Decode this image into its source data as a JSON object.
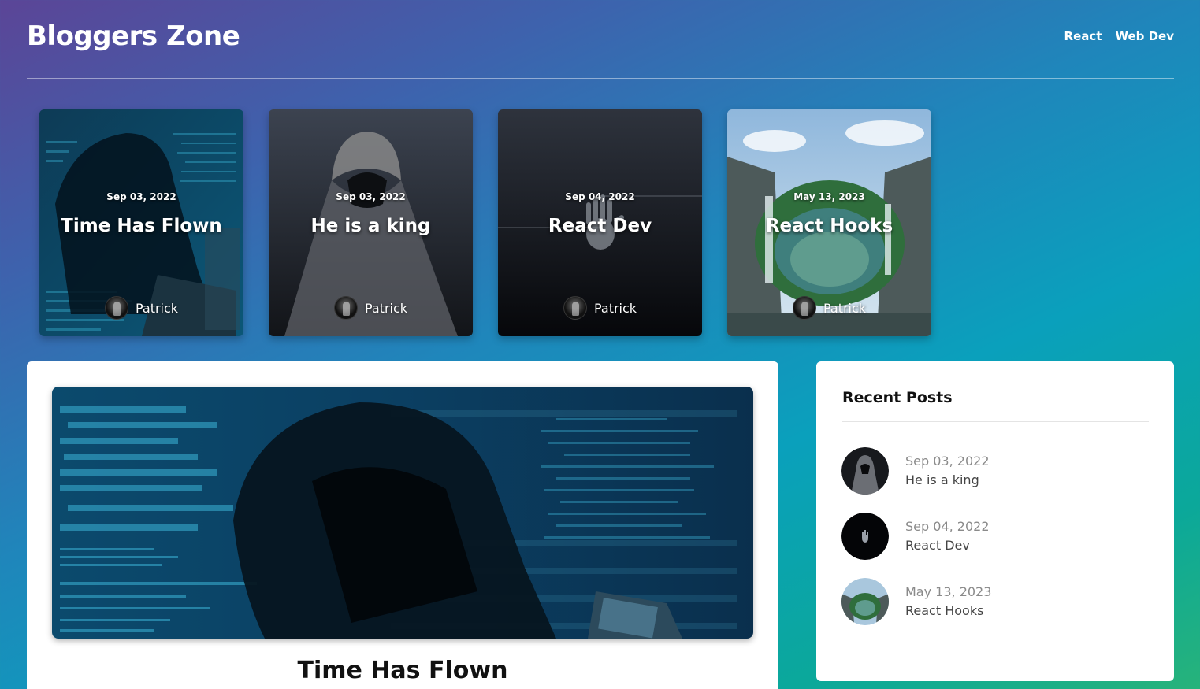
{
  "header": {
    "brand": "Bloggers Zone",
    "nav": [
      "React",
      "Web Dev"
    ]
  },
  "cards": [
    {
      "date": "Sep 03, 2022",
      "title": "Time Has Flown",
      "author": "Patrick"
    },
    {
      "date": "Sep 03, 2022",
      "title": "He is a king",
      "author": "Patrick"
    },
    {
      "date": "Sep 04, 2022",
      "title": "React Dev",
      "author": "Patrick"
    },
    {
      "date": "May 13, 2023",
      "title": "React Hooks",
      "author": "Patrick"
    }
  ],
  "main": {
    "post_title": "Time Has Flown"
  },
  "sidebar": {
    "title": "Recent Posts",
    "items": [
      {
        "date": "Sep 03, 2022",
        "title": "He is a king"
      },
      {
        "date": "Sep 04, 2022",
        "title": "React Dev"
      },
      {
        "date": "May 13, 2023",
        "title": "React Hooks"
      }
    ]
  }
}
